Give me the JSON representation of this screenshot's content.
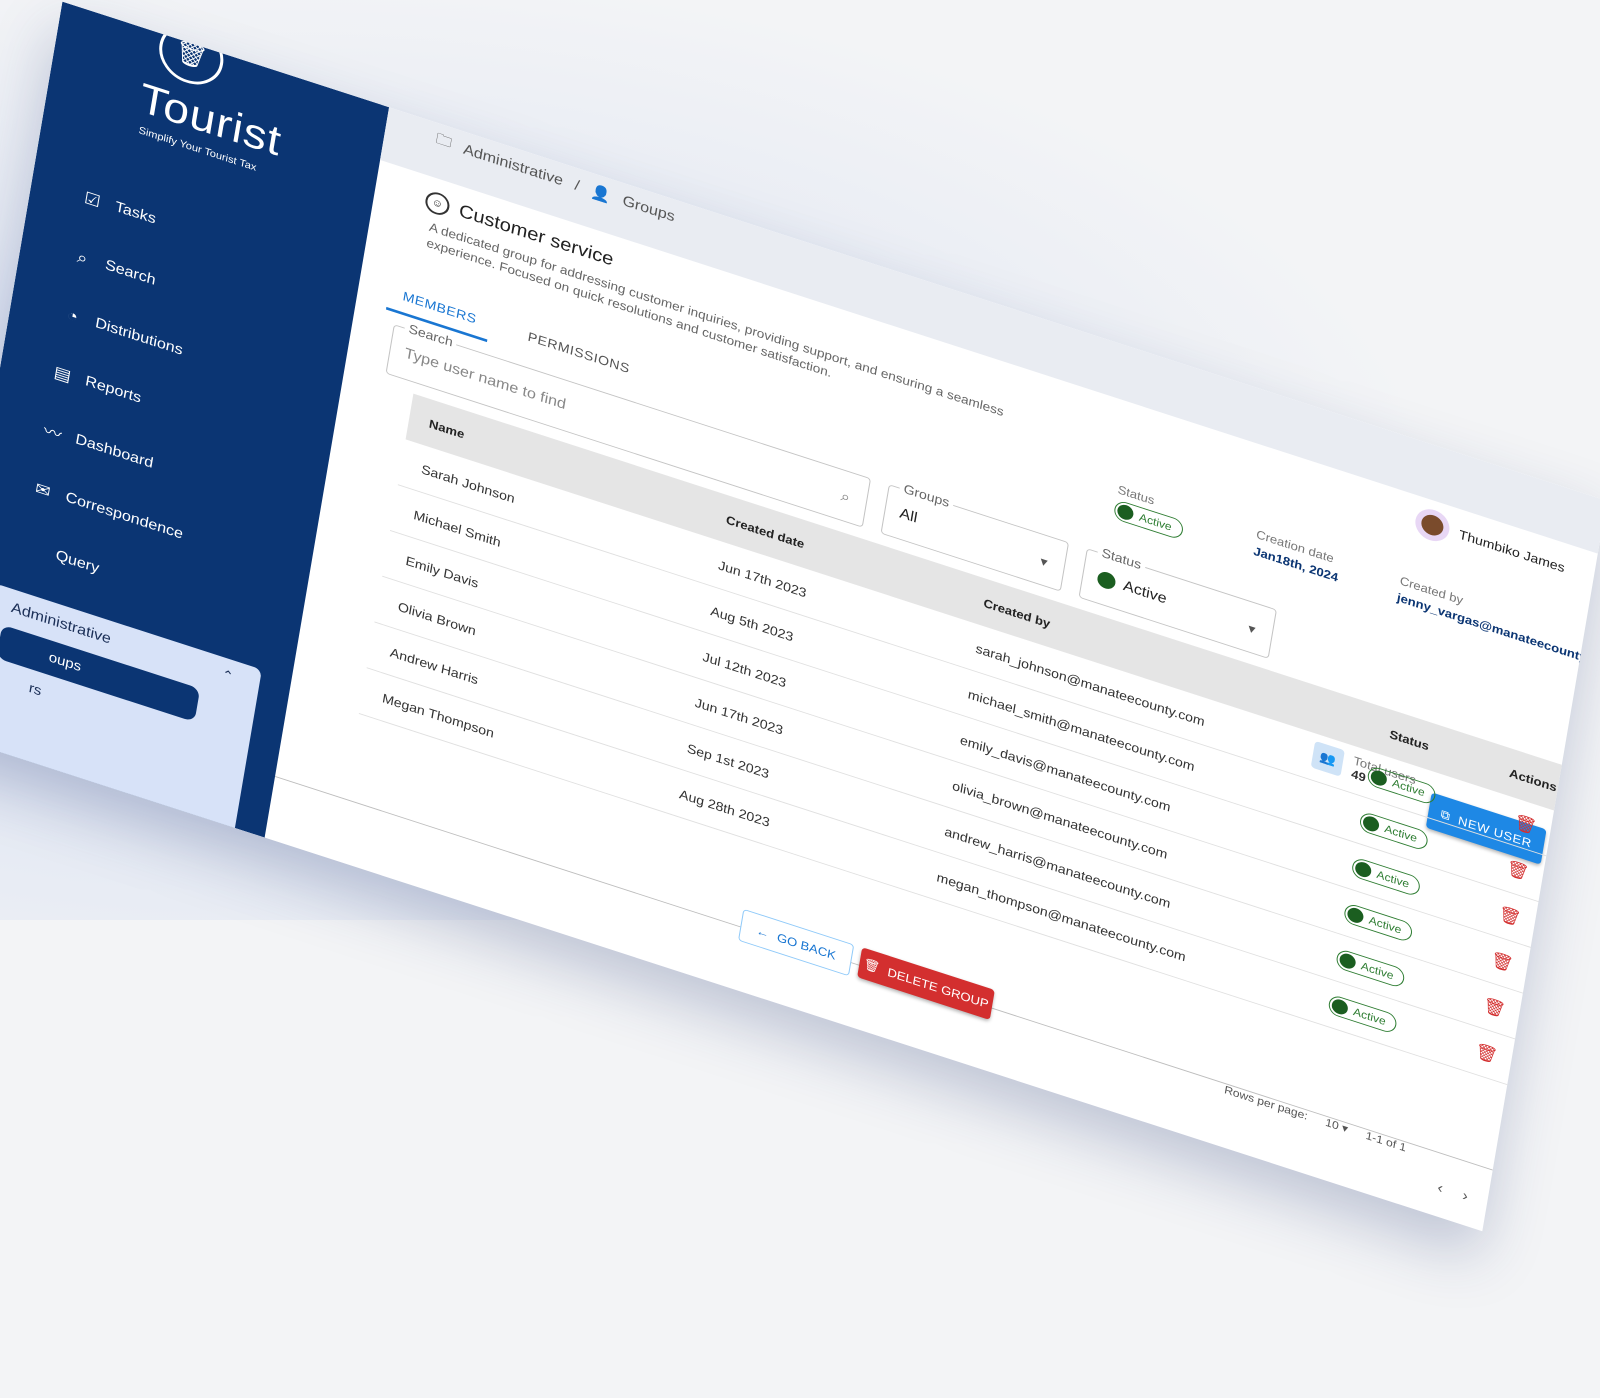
{
  "brand": {
    "name": "Tourist",
    "tagline": "Simplify Your Tourist Tax",
    "logo_icon": "trash-can-logo"
  },
  "nav": [
    {
      "label": "Tasks",
      "icon": "tasks-icon",
      "glyph": "☑"
    },
    {
      "label": "Search",
      "icon": "search-icon",
      "glyph": "⌕"
    },
    {
      "label": "Distributions",
      "icon": "pie-chart-icon",
      "glyph": "◔"
    },
    {
      "label": "Reports",
      "icon": "report-icon",
      "glyph": "▤"
    },
    {
      "label": "Dashboard",
      "icon": "trend-icon",
      "glyph": "〰"
    },
    {
      "label": "Correspondence",
      "icon": "mail-icon",
      "glyph": "✉"
    },
    {
      "label": "Query",
      "icon": "query-icon",
      "glyph": ""
    }
  ],
  "admin": {
    "label": "Administrative",
    "groups_label": "oups",
    "users_label": "rs"
  },
  "breadcrumb": {
    "parent": "Administrative",
    "separator": "/",
    "current": "Groups"
  },
  "group": {
    "title": "Customer service",
    "description": "A dedicated group for addressing customer inquiries, providing support, and ensuring a seamless experience. Focused on quick resolutions and customer satisfaction."
  },
  "user": {
    "name": "Thumbiko James"
  },
  "meta": {
    "status_label": "Status",
    "status_value": "Active",
    "creation_label": "Creation date",
    "creation_value": "Jan18th, 2024",
    "created_by_label": "Created by",
    "created_by_value": "jenny_vargas@manateecounty.com"
  },
  "tabs": {
    "members": "MEMBERS",
    "permissions": "PERMISSIONS"
  },
  "filters": {
    "search_label": "Search",
    "search_placeholder": "Type user name to find",
    "groups_label": "Groups",
    "groups_value": "All",
    "status_label": "Status",
    "status_value": "Active"
  },
  "totals": {
    "label": "Total users",
    "value": "49"
  },
  "buttons": {
    "new_user": "NEW USER",
    "go_back": "GO BACK",
    "delete_group": "DELETE GROUP"
  },
  "table": {
    "columns": {
      "name": "Name",
      "created_date": "Created date",
      "created_by": "Created by",
      "status": "Status",
      "actions": "Actions"
    },
    "rows": [
      {
        "name": "Sarah Johnson",
        "date": "Jun 17th 2023",
        "by": "sarah_johnson@manateecounty.com",
        "status": "Active"
      },
      {
        "name": "Michael Smith",
        "date": "Aug 5th 2023",
        "by": "michael_smith@manateecounty.com",
        "status": "Active"
      },
      {
        "name": "Emily Davis",
        "date": "Jul 12th 2023",
        "by": "emily_davis@manateecounty.com",
        "status": "Active"
      },
      {
        "name": "Olivia Brown",
        "date": "Jun 17th 2023",
        "by": "olivia_brown@manateecounty.com",
        "status": "Active"
      },
      {
        "name": "Andrew Harris",
        "date": "Sep 1st 2023",
        "by": "andrew_harris@manateecounty.com",
        "status": "Active"
      },
      {
        "name": "Megan Thompson",
        "date": "Aug 28th 2023",
        "by": "megan_thompson@manateecounty.com",
        "status": "Active"
      }
    ]
  },
  "pagination": {
    "rows_label": "Rows per page:",
    "rows_value": "10",
    "range": "1-1 of 1"
  },
  "colors": {
    "sidebar": "#0b3573",
    "primary": "#1e88e5",
    "danger": "#d32f2f",
    "success": "#2e7d32"
  }
}
